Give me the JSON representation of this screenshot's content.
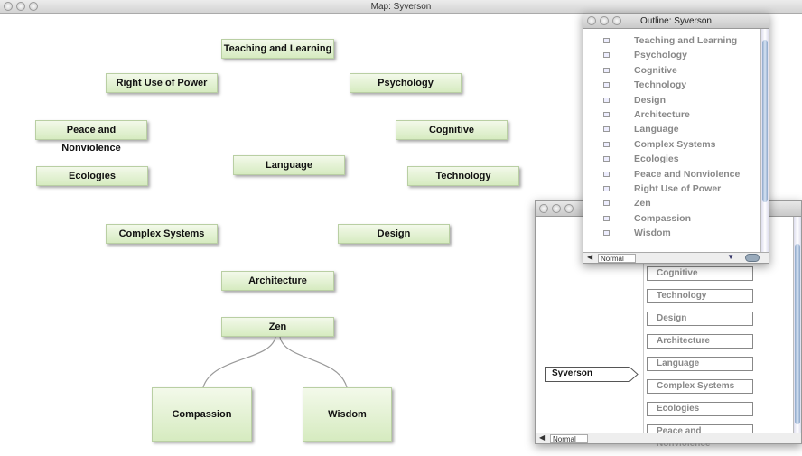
{
  "window": {
    "title": "Map: Syverson"
  },
  "map": {
    "nodes": [
      "Teaching and Learning",
      "Right Use of Power",
      "Psychology",
      "Peace and Nonviolence",
      "Cognitive",
      "Language",
      "Ecologies",
      "Technology",
      "Complex Systems",
      "Design",
      "Architecture",
      "Zen",
      "Compassion",
      "Wisdom"
    ]
  },
  "outline": {
    "title": "Outline: Syverson",
    "items": [
      "Teaching and Learning",
      "Psychology",
      "Cognitive",
      "Technology",
      "Design",
      "Architecture",
      "Language",
      "Complex Systems",
      "Ecologies",
      "Peace and Nonviolence",
      "Right Use of Power",
      "Zen",
      "Compassion",
      "Wisdom"
    ],
    "mode": "Normal"
  },
  "browser": {
    "root": "Syverson",
    "items": [
      "Cognitive",
      "Technology",
      "Design",
      "Architecture",
      "Language",
      "Complex Systems",
      "Ecologies",
      "Peace and Nonviolence"
    ],
    "mode": "Normal"
  }
}
